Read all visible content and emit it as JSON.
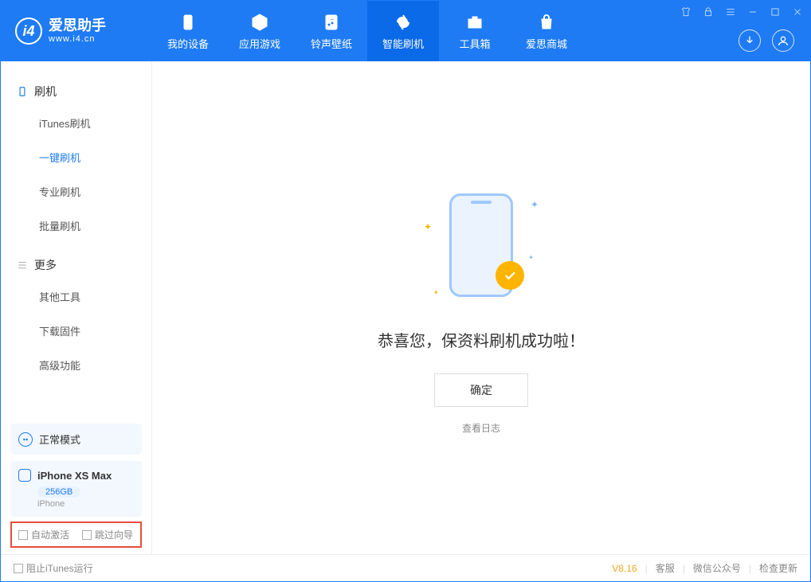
{
  "app": {
    "title": "爱思助手",
    "subtitle": "www.i4.cn"
  },
  "nav": {
    "tabs": [
      {
        "label": "我的设备",
        "icon": "phone-icon"
      },
      {
        "label": "应用游戏",
        "icon": "cube-icon"
      },
      {
        "label": "铃声壁纸",
        "icon": "music-icon"
      },
      {
        "label": "智能刷机",
        "icon": "refresh-icon",
        "active": true
      },
      {
        "label": "工具箱",
        "icon": "toolbox-icon"
      },
      {
        "label": "爱思商城",
        "icon": "bag-icon"
      }
    ]
  },
  "sidebar": {
    "section1": {
      "title": "刷机",
      "items": [
        "iTunes刷机",
        "一键刷机",
        "专业刷机",
        "批量刷机"
      ],
      "activeIndex": 1
    },
    "section2": {
      "title": "更多",
      "items": [
        "其他工具",
        "下载固件",
        "高级功能"
      ]
    },
    "mode": "正常模式",
    "device": {
      "name": "iPhone XS Max",
      "storage": "256GB",
      "type": "iPhone"
    },
    "checkboxes": {
      "autoActivate": "自动激活",
      "skipGuide": "跳过向导"
    }
  },
  "main": {
    "successMessage": "恭喜您，保资料刷机成功啦！",
    "okButton": "确定",
    "viewLog": "查看日志"
  },
  "footer": {
    "blockItunes": "阻止iTunes运行",
    "version": "V8.16",
    "links": [
      "客服",
      "微信公众号",
      "检查更新"
    ]
  }
}
